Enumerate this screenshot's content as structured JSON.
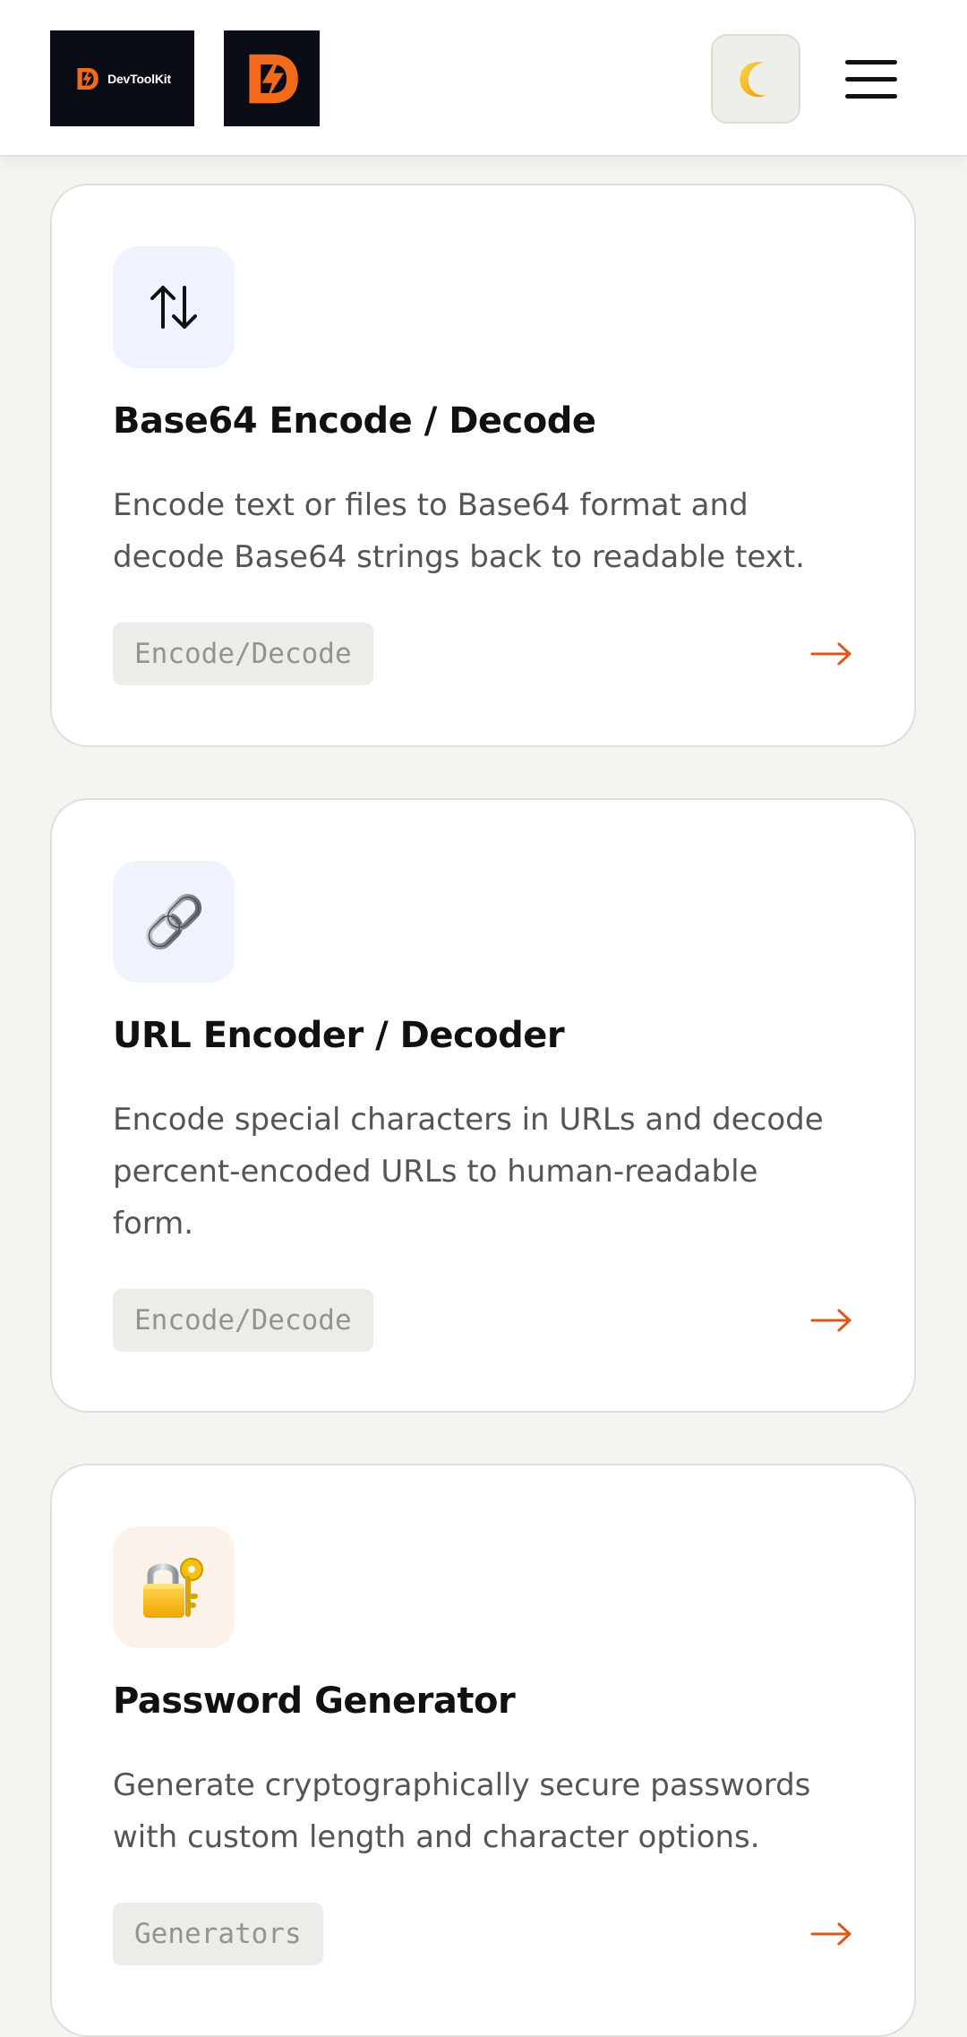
{
  "header": {
    "logo_text": "DevToolKit",
    "theme_toggle_icon": "moon-icon",
    "menu_icon": "hamburger-icon"
  },
  "colors": {
    "accent": "#d9581a",
    "brand_orange": "#f26a1b",
    "logo_bg": "#0a0d16",
    "page_bg": "#f4f4f0"
  },
  "tools": [
    {
      "icon": "up-down-arrows-icon",
      "title": "Base64 Encode / Decode",
      "description": "Encode text or files to Base64 format and decode Base64 strings back to readable text.",
      "tag": "Encode/Decode",
      "arrow": "arrow-right-icon"
    },
    {
      "icon": "link-icon",
      "title": "URL Encoder / Decoder",
      "description": "Encode special characters in URLs and decode percent-encoded URLs to human-readable form.",
      "tag": "Encode/Decode",
      "arrow": "arrow-right-icon"
    },
    {
      "icon": "lock-key-icon",
      "title": "Password Generator",
      "description": "Generate cryptographically secure passwords with custom length and character options.",
      "tag": "Generators",
      "arrow": "arrow-right-icon"
    }
  ]
}
